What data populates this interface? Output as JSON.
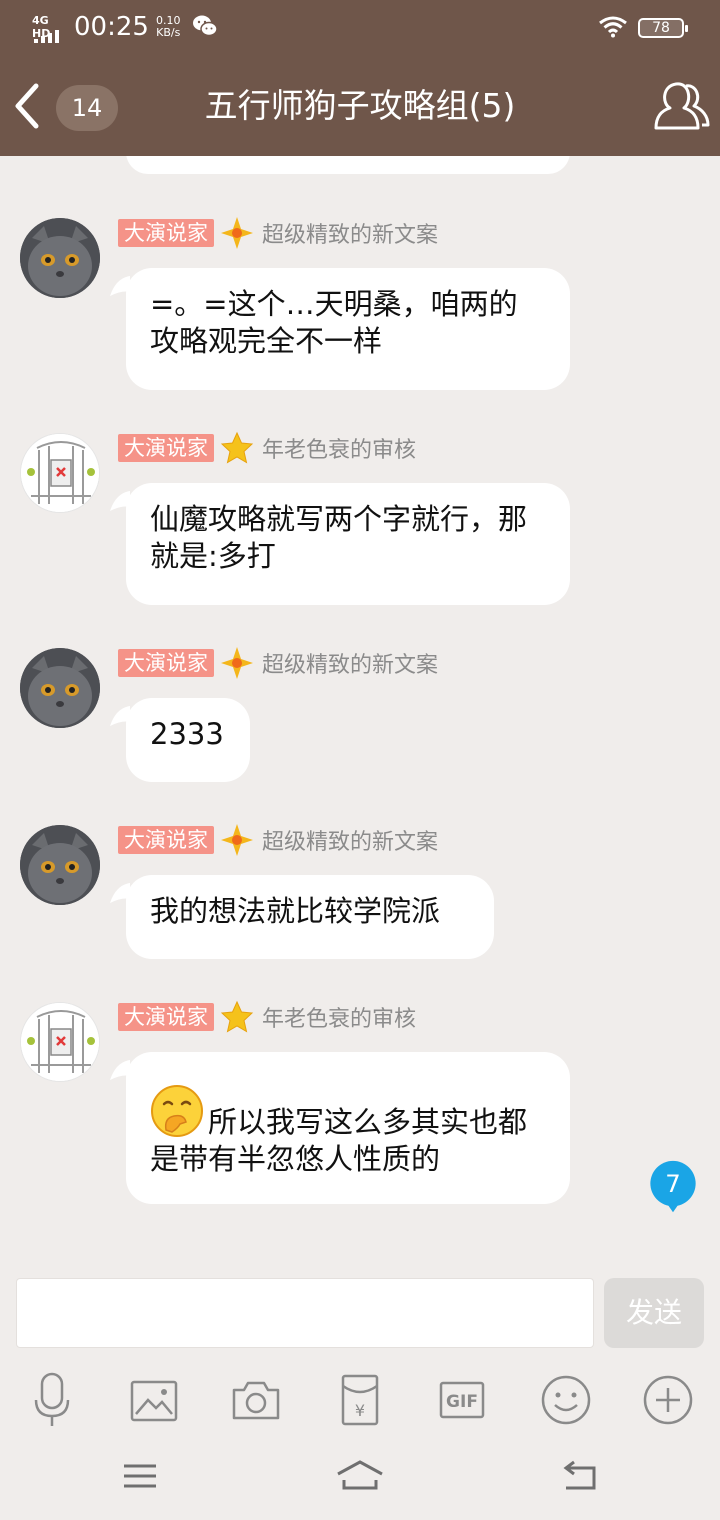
{
  "status_bar": {
    "network": "4G HD",
    "time": "00:25",
    "speed_value": "0.10",
    "speed_unit": "KB/s",
    "battery": "78"
  },
  "header": {
    "unread_count": "14",
    "title": "五行师狗子攻略组(5)"
  },
  "messages": [
    {
      "badge": "大演说家",
      "nickname": "超级精致的新文案",
      "avatar": "cat-avatar",
      "icon": "orange-diamond-star-icon",
      "text": "=。=这个…天明桑，咱两的攻略观完全不一样"
    },
    {
      "badge": "大演说家",
      "nickname": "年老色衰的审核",
      "avatar": "gate-avatar",
      "icon": "gold-star-icon",
      "text": "仙魔攻略就写两个字就行，那就是:多打"
    },
    {
      "badge": "大演说家",
      "nickname": "超级精致的新文案",
      "avatar": "cat-avatar",
      "icon": "orange-diamond-star-icon",
      "text": "2333"
    },
    {
      "badge": "大演说家",
      "nickname": "超级精致的新文案",
      "avatar": "cat-avatar",
      "icon": "orange-diamond-star-icon",
      "text": "我的想法就比较学院派"
    },
    {
      "badge": "大演说家",
      "nickname": "年老色衰的审核",
      "avatar": "gate-avatar",
      "icon": "gold-star-icon",
      "emoji": "face-with-hand-over-mouth-emoji",
      "text": "所以我写这么多其实也都是带有半忽悠人性质的"
    }
  ],
  "new_message_count": "7",
  "input": {
    "value": "",
    "placeholder": "",
    "send_label": "发送"
  },
  "toolbar": {
    "gif_label": "GIF",
    "redpacket_symbol": "¥"
  },
  "colors": {
    "header_bg": "#6f564a",
    "chat_bg": "#f0edeb",
    "badge_bg": "#f59388",
    "new_badge": "#1aa5e6",
    "send_disabled": "#dcdad8"
  }
}
